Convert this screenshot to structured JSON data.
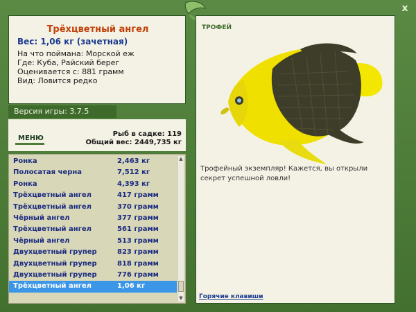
{
  "close_label": "x",
  "fish": {
    "name": "Трёхцветный ангел",
    "weight": "Вес: 1,06 кг (зачетная)",
    "bait": "На что поймана: Морской еж",
    "place": "Где: Куба, Райский берег",
    "valued": "Оценивается с: 881 грамм",
    "kind": "Вид: Ловится редко"
  },
  "version": "Версия игры: 3.7.5",
  "menu_label": "МЕНЮ",
  "stats": {
    "in_cage": "Рыб в садке: 119",
    "total_weight": "Общий вес: 2449,735 кг"
  },
  "catch_list": [
    {
      "name": "Ронка",
      "weight": "2,463 кг"
    },
    {
      "name": "Полосатая черна",
      "weight": "7,512 кг"
    },
    {
      "name": "Ронка",
      "weight": "4,393 кг"
    },
    {
      "name": "Трёхцветный ангел",
      "weight": "417 грамм"
    },
    {
      "name": "Трёхцветный ангел",
      "weight": "370 грамм"
    },
    {
      "name": "Чёрный ангел",
      "weight": "377 грамм"
    },
    {
      "name": "Трёхцветный ангел",
      "weight": "561 грамм"
    },
    {
      "name": "Чёрный ангел",
      "weight": "513 грамм"
    },
    {
      "name": "Двухцветный групер",
      "weight": "823 грамм"
    },
    {
      "name": "Двухцветный групер",
      "weight": "818 грамм"
    },
    {
      "name": "Двухцветный групер",
      "weight": "776 грамм"
    },
    {
      "name": "Трёхцветный ангел",
      "weight": "1,06 кг"
    }
  ],
  "selected_index": 11,
  "trophy": {
    "title": "ТРОФЕЙ",
    "text": "Трофейный экземпляр! Кажется, вы открыли секрет успешной ловли!"
  },
  "hotkeys": "Горячие клавиши",
  "colors": {
    "frame_green": "#4e7a3c",
    "panel_bg": "#f4f2e4",
    "fish_name": "#c1420c",
    "selected_row": "#3c96e8"
  }
}
